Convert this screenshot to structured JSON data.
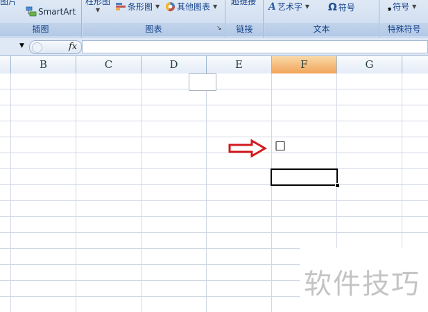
{
  "ribbon": {
    "groups": {
      "illustrations": {
        "title": "插图",
        "items": [
          "图片",
          "SmartArt"
        ]
      },
      "charts": {
        "title": "图表",
        "items": [
          "柱形图",
          "条形图",
          "其他图表"
        ]
      },
      "links": {
        "title": "链接",
        "items": [
          "超链接"
        ]
      },
      "text": {
        "title": "文本",
        "items": [
          "艺术字",
          "符号"
        ]
      },
      "special": {
        "title": "特殊符号",
        "items": [
          "符号"
        ]
      }
    }
  },
  "formula_bar": {
    "fx": "fx",
    "value": ""
  },
  "columns": [
    "B",
    "C",
    "D",
    "E",
    "F",
    "G"
  ],
  "active_column": "F",
  "cell_content": "□",
  "colors": {
    "arrow": "#d2191d",
    "active_header": "#f1a45b",
    "grid": "#d0d7e5"
  },
  "watermark": "软件技巧"
}
